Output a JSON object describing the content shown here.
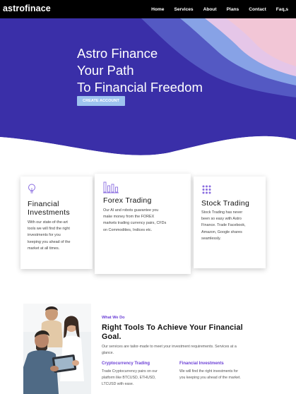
{
  "nav": {
    "brand": "astrofinace",
    "links": [
      "Home",
      "Services",
      "About",
      "Plans",
      "Contact",
      "Faq,s"
    ]
  },
  "hero": {
    "title_lines": [
      "Astro Finance",
      "Your Path",
      "To Financial Freedom"
    ],
    "cta_label": "CREATE ACCOUNT",
    "colors": {
      "primary": "#3a2fa8",
      "light": "#8aa6e8",
      "pink": "#f2c6d6",
      "button": "#9ec3ef"
    }
  },
  "features": [
    {
      "icon": "lightbulb-icon",
      "title_lines": [
        "Financial",
        "Investments"
      ],
      "text_lines": [
        "With our state-of-the-art",
        "tools we will find the right",
        "investments for you",
        "keeping you ahead of the",
        "market at all times."
      ]
    },
    {
      "icon": "bar-chart-icon",
      "title_lines": [
        "Forex Trading"
      ],
      "text_lines": [
        "Our AI and robots guarantee you",
        "make money from the FOREX",
        "markets trading currency pairs, CFDs",
        "on Commodities, Indices etc."
      ]
    },
    {
      "icon": "grid-dots-icon",
      "title_lines": [
        "Stock Trading"
      ],
      "text_lines": [
        "Stock Trading has never",
        "been so easy with Astro",
        "Finance. Trade Facebook,",
        "Amazon, Google shares",
        "seamlessly."
      ]
    }
  ],
  "about": {
    "kicker": "What We Do",
    "title_lines": [
      "Right Tools To Achieve Your Financial",
      "Goal."
    ],
    "desc_lines": [
      "Our services are tailor-made to meet your investment requirements. Services at a",
      "glance."
    ],
    "items": [
      {
        "title": "Cryptocurrency Trading",
        "text_lines": [
          "Trade Cryptocurrency pairs on our",
          "platform like BTCUSD, ETHUSD,",
          "LTCUSD with ease."
        ]
      },
      {
        "title": "Financial Investments",
        "text_lines": [
          "We will find the right investments for",
          "you keeping you ahead of the market."
        ]
      }
    ]
  },
  "accent_color": "#6b3fd6"
}
